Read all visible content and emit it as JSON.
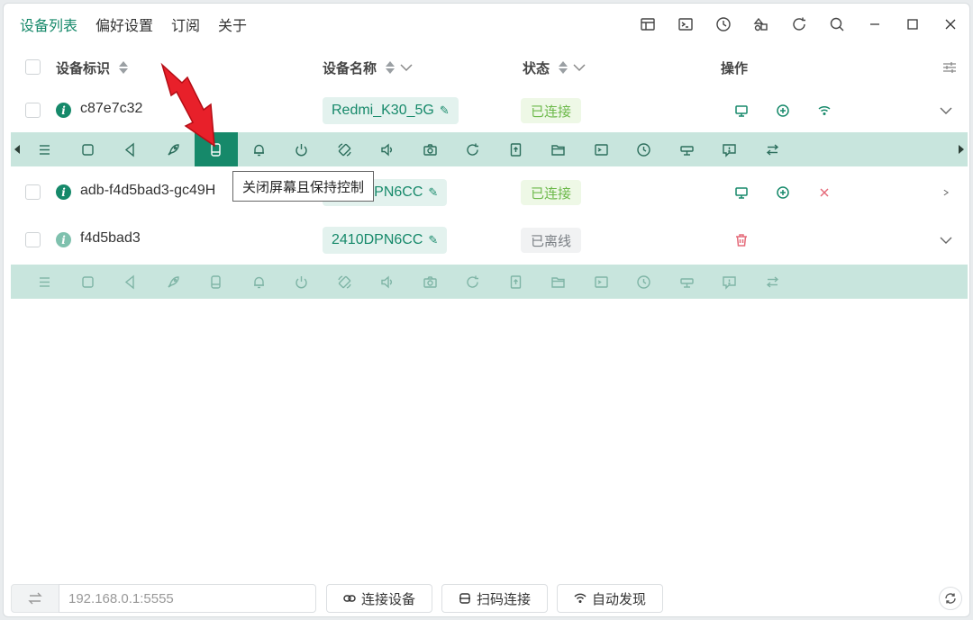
{
  "nav": {
    "tabs": [
      "设备列表",
      "偏好设置",
      "订阅",
      "关于"
    ]
  },
  "table": {
    "headers": {
      "id": "设备标识",
      "name": "设备名称",
      "status": "状态",
      "actions": "操作"
    },
    "rows": [
      {
        "id": "c87e7c32",
        "name": "Redmi_K30_5G",
        "status": "已连接"
      },
      {
        "id": "adb-f4d5bad3-gc49H",
        "name": "2410DPN6CC",
        "status": "已连接"
      },
      {
        "id": "f4d5bad3",
        "name": "2410DPN6CC",
        "status": "已离线"
      }
    ]
  },
  "tooltip": "关闭屏幕且保持控制",
  "bottom": {
    "ip_value": "192.168.0.1:5555",
    "connect_label": "连接设备",
    "scan_label": "扫码连接",
    "discover_label": "自动发现"
  },
  "colors": {
    "accent": "#16896a",
    "toolbar_bg": "#c8e5dd",
    "connected": "#6cb94a",
    "danger": "#e56b7a"
  }
}
